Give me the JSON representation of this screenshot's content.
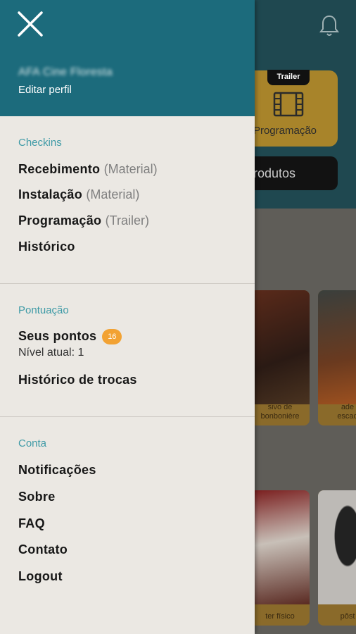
{
  "background": {
    "card": {
      "tag": "Trailer",
      "label": "Programação"
    },
    "produtos_label": "rodutos",
    "posters": [
      {
        "caption": "sivo de\nbonbonière"
      },
      {
        "caption": "ade\nescad"
      },
      {
        "caption": "ter físico"
      },
      {
        "caption": "pôst"
      }
    ]
  },
  "drawer": {
    "profile_name": "AFA Cine Floresta",
    "edit_profile": "Editar perfil",
    "checkins": {
      "title": "Checkins",
      "items": [
        {
          "label": "Recebimento",
          "sub": "(Material)"
        },
        {
          "label": "Instalação",
          "sub": "(Material)"
        },
        {
          "label": "Programação",
          "sub": "(Trailer)"
        },
        {
          "label": "Histórico",
          "sub": ""
        }
      ]
    },
    "pontuacao": {
      "title": "Pontuação",
      "points_label": "Seus pontos",
      "points_badge": "16",
      "level": "Nível atual: 1",
      "history": "Histórico de trocas"
    },
    "conta": {
      "title": "Conta",
      "items": [
        "Notificações",
        "Sobre",
        "FAQ",
        "Contato",
        "Logout"
      ]
    }
  },
  "colors": {
    "header": "#1c6b7c",
    "drawer_bg": "#ebe8e3",
    "section_title": "#3e9aa6",
    "badge": "#f2a233"
  }
}
